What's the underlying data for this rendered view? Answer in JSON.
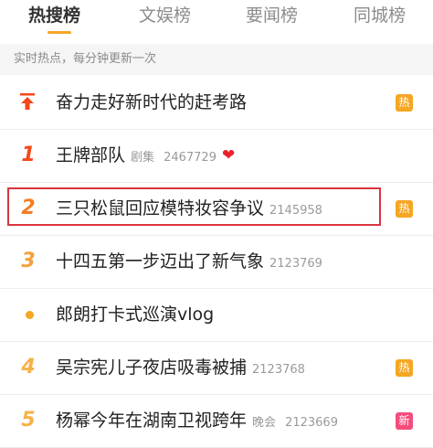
{
  "tabs": [
    {
      "label": "热搜榜",
      "active": true
    },
    {
      "label": "文娱榜",
      "active": false
    },
    {
      "label": "要闻榜",
      "active": false
    },
    {
      "label": "同城榜",
      "active": false
    }
  ],
  "notice": "实时热点，每分钟更新一次",
  "rows": [
    {
      "rank": "",
      "rank_icon": "pin-top-icon",
      "title": "奋力走好新时代的赶考路",
      "category": "",
      "count": "",
      "tag": "热"
    },
    {
      "rank": "1",
      "title": "王牌部队",
      "category": "剧集",
      "count": "2467729",
      "trailing_icon": "heart-icon",
      "tag": ""
    },
    {
      "rank": "2",
      "title": "三只松鼠回应模特妆容争议",
      "category": "",
      "count": "2145958",
      "tag": "热"
    },
    {
      "rank": "3",
      "title": "十四五第一步迈出了新气象",
      "category": "",
      "count": "2123769",
      "tag": ""
    },
    {
      "rank": "",
      "rank_icon": "dot-icon",
      "title": "郎朗打卡式巡演vlog",
      "category": "",
      "count": "",
      "tag": ""
    },
    {
      "rank": "4",
      "title": "吴宗宪儿子夜店吸毒被捕",
      "category": "",
      "count": "2123768",
      "tag": "热"
    },
    {
      "rank": "5",
      "title": "杨幂今年在湖南卫视跨年",
      "category": "晚会",
      "count": "2123669",
      "tag": "新"
    }
  ],
  "colors": {
    "accent": "#f5a623",
    "hot_tag": "#f5a623",
    "new_tag": "#f44d7c",
    "highlight": "#d9363e"
  }
}
